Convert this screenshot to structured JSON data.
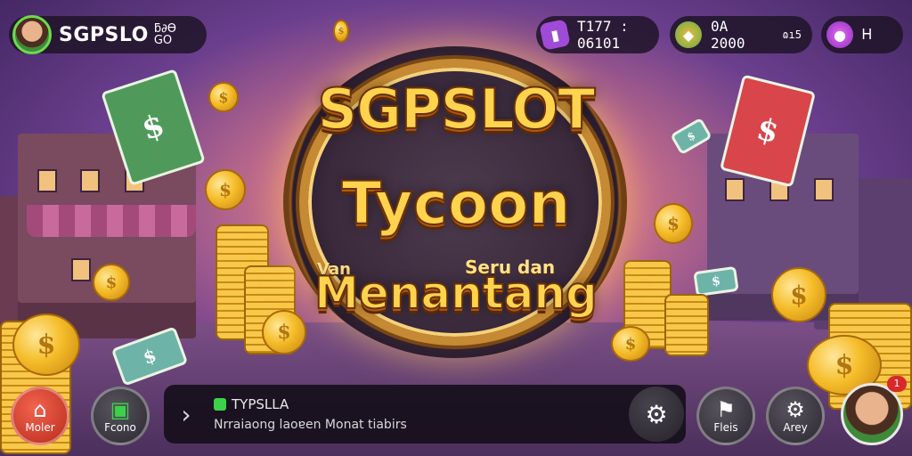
{
  "header": {
    "profile": {
      "name": "SGPSLO",
      "level_text": "ƃ∂Ɵ\nGO"
    },
    "resources": [
      {
        "icon": "card-icon",
        "value": "T177 : 06101"
      },
      {
        "icon": "gem-icon",
        "value": "0A 2000"
      },
      {
        "icon": "monster-icon",
        "value": "Ꮋ"
      }
    ],
    "resource2_suffix": "ɷı5"
  },
  "hero": {
    "title": "SGPSLOT",
    "subtitle": "Tycoon",
    "tagline_left": "Van",
    "tagline_right": "Seru dan",
    "tagline_main": "Menantang"
  },
  "bottom_bar": {
    "home_label": "Moler",
    "feed_label": "Fcono",
    "chat": {
      "title": "TYPSLLA",
      "message": "Nrraiaong laoɐen Monat tiabirs"
    },
    "flag_label": "Fleis",
    "arey_label": "Arey",
    "avatar_badge": "1"
  },
  "colors": {
    "title_gold": "#ffd34d",
    "home_red": "#d43c2b",
    "chat_green": "#3bd14a",
    "bg_purple": "#6b3f8e"
  }
}
